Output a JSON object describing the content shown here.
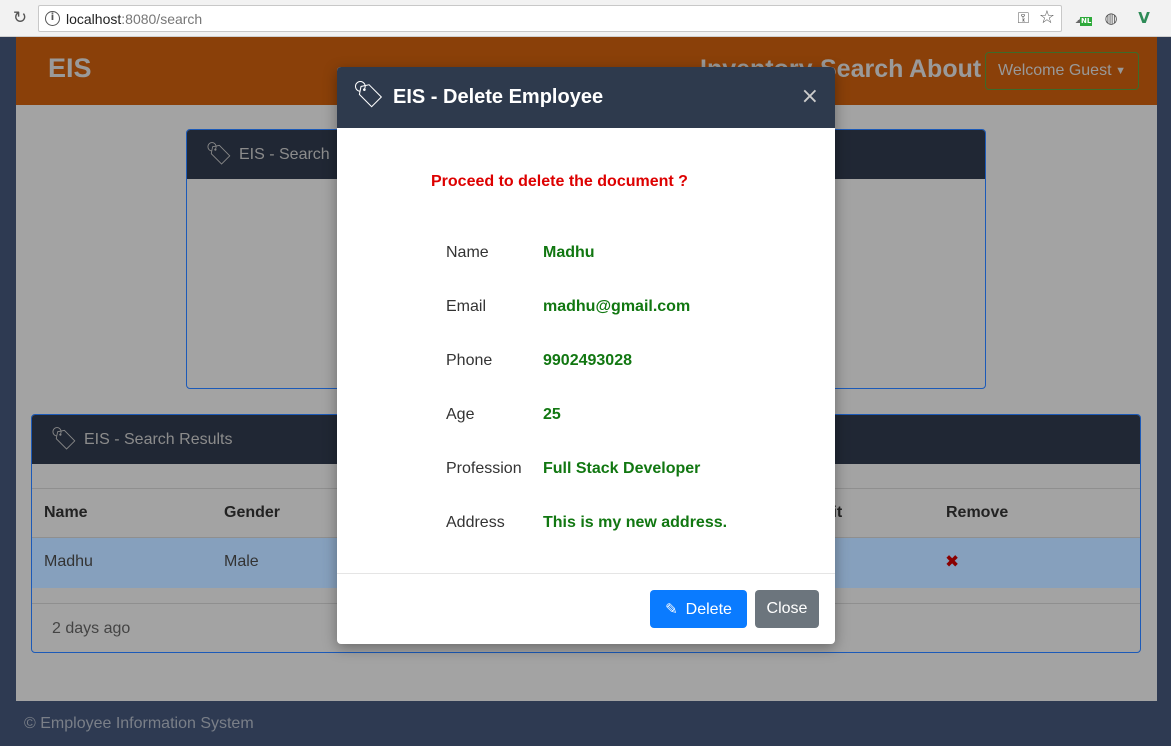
{
  "browser": {
    "url_host": "localhost",
    "url_path": ":8080/search",
    "extension_badge": "NL"
  },
  "navbar": {
    "brand": "EIS",
    "links": [
      "Inventory",
      "Search",
      "About"
    ],
    "welcome": "Welcome Guest"
  },
  "search_card": {
    "title": "EIS - Search"
  },
  "results_card": {
    "title": "EIS - Search Results",
    "columns": [
      "Name",
      "Gender",
      "Edit",
      "Remove"
    ],
    "rows": [
      {
        "name": "Madhu",
        "gender": "Male"
      }
    ],
    "footer": "2 days ago"
  },
  "footer": {
    "text": "© Employee Information System"
  },
  "modal": {
    "title": "EIS - Delete Employee",
    "close_symbol": "×",
    "confirm_text": "Proceed to delete the document ?",
    "fields": [
      {
        "label": "Name",
        "value": "Madhu"
      },
      {
        "label": "Email",
        "value": "madhu@gmail.com"
      },
      {
        "label": "Phone",
        "value": "9902493028"
      },
      {
        "label": "Age",
        "value": "25"
      },
      {
        "label": "Profession",
        "value": "Full Stack Developer"
      },
      {
        "label": "Address",
        "value": "This is my new address."
      }
    ],
    "delete_label": "Delete",
    "close_label": "Close"
  },
  "colors": {
    "navbar": "#8a4009",
    "card_border": "#1c5ab8",
    "modal_header": "#2e3a4d",
    "confirm_text": "#dd0000",
    "field_value": "#117711",
    "delete_button": "#0a7bff",
    "close_button": "#6c757d"
  },
  "icons": {
    "reload": "reload-icon",
    "info": "info-icon",
    "key": "key-icon",
    "star": "bookmark-star-icon",
    "tag": "tags-icon",
    "edit": "edit-icon",
    "remove": "remove-x-icon"
  }
}
